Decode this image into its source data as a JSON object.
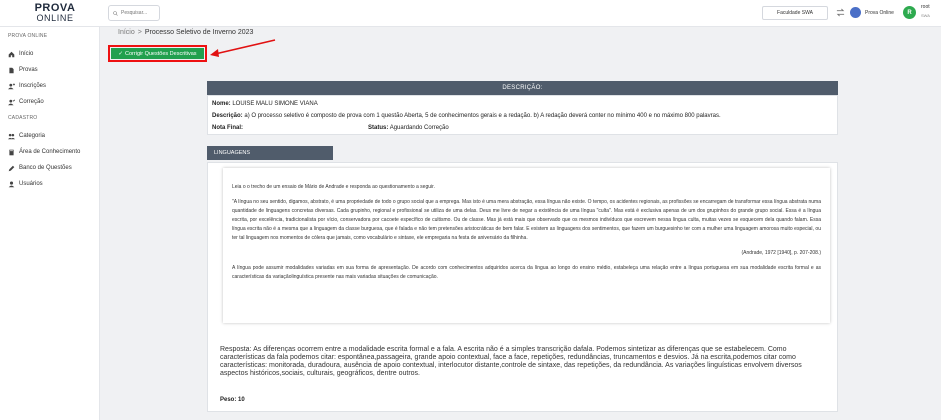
{
  "app": {
    "logo_line1": "PROVA",
    "logo_line2": "ONLINE"
  },
  "header": {
    "search_placeholder": "Pesquisar...",
    "faculdade": "Faculdade SWA",
    "prova_online_label": "Prova Online",
    "avatar_initial": "R",
    "user_name": "root",
    "user_role": "SWA"
  },
  "sidebar": {
    "section1": "PROVA ONLINE",
    "items1": [
      {
        "label": "Início",
        "icon": "home-icon"
      },
      {
        "label": "Provas",
        "icon": "document-icon"
      },
      {
        "label": "Inscrições",
        "icon": "user-plus-icon"
      },
      {
        "label": "Correção",
        "icon": "user-check-icon"
      }
    ],
    "section2": "CADASTRO",
    "items2": [
      {
        "label": "Categoria",
        "icon": "users-icon"
      },
      {
        "label": "Área de Conhecimento",
        "icon": "book-icon"
      },
      {
        "label": "Banco de Questões",
        "icon": "pencil-icon"
      },
      {
        "label": "Usuários",
        "icon": "user-icon"
      }
    ]
  },
  "breadcrumb": {
    "home": "Início",
    "separator": ">",
    "current": "Processo Seletivo de Inverno 2023"
  },
  "action": {
    "button_label": "Corrigir Questões Descritivas"
  },
  "description": {
    "header": "DESCRIÇÃO:",
    "name_label": "Nome:",
    "name_value": "LOUISE MALU SIMONE VIANA",
    "desc_label": "Descrição:",
    "desc_value": "a) O processo seletivo é composto de prova com 1 questão Aberta, 5 de conhecimentos gerais e a redação. b) A redação deverá conter no mínimo 400 e no máximo 800 palavras.",
    "final_label": "Nota Final:",
    "status_label": "Status:",
    "status_value": "Aguardando Correção"
  },
  "tab": {
    "label": "LINGUAGENS"
  },
  "question": {
    "intro": "Leia o o trecho de um ensaio de Mário de Andrade e responda ao questionamento a seguir.",
    "quote": "\"A língua no seu sentido, digamos, abstrato, é uma propriedade de todo o grupo social que a emprega. Mas isto é uma mera abstração, essa língua não existe. O tempo, os acidentes regionais, as profissões se encarregam de transformar essa língua abstrata numa quantidade de linguagens concretas diversas. Cada grupinho, regional e profissional se utiliza de uma delas. Deus me livre de negar a existência de uma língua \"culta\". Mas está é exclusiva apenas de um dos grupinhos do grande grupo social. Essa é a língua escrita, por excelência, tradicionalista por vício, conservadora por cacoete específico de cultismo. Ou de classe. Mas já está mais que observado que os mesmos indivíduos que escrevem nessa língua culta, muitas vezes se esquecem dela quando falam. Essa língua escrita não é a mesma que a linguagem da classe burguesa, que é falada e não tem pretensões aristocráticas de bem falar. E existem as linguagens dos sentimentos, que fazem um burguesinho ter com a mulher uma linguagem amorosa muito especial, ou ter tal linguagem nos momentos de cólera que jamais, como vocabulário e sintaxe, ele empregaria na festa de aniversário da filhinha.",
    "citation": "(Andrade, 1972 [1940], p. 207-208.)",
    "prompt": "A língua pode assumir modalidades variadas em sua forma de apresentação. De acordo com conhecimentos adquiridos acerca da língua ao longo do ensino médio, estabeleça uma relação entre a língua portuguesa em sua modalidade escrita formal e as características da variaçãolinguística presente nas mais variadas situações de comunicação.",
    "answer": "Resposta: As diferenças ocorrem entre a modalidade escrita formal e a fala. A escrita não é a simples transcrição dafala. Podemos sintetizar as diferenças que se estabelecem. Como características da fala podemos citar: espontânea,passageira, grande apoio contextual, face a face, repetições, redundâncias, truncamentos e desvios.  Já na escrita,podemos citar como características: monitorada, duradoura, ausência de apoio contextual, interlocutor distante,controle de sintaxe, das repetições, da redundância. As variações linguísticas envolvem diversos aspectos históricos,sociais, culturais, geográficos, dentre outros.",
    "peso": "Peso: 10"
  },
  "colors": {
    "accent_green": "#21a04e",
    "panel_header": "#505c6b",
    "highlight_red": "#e11111"
  }
}
